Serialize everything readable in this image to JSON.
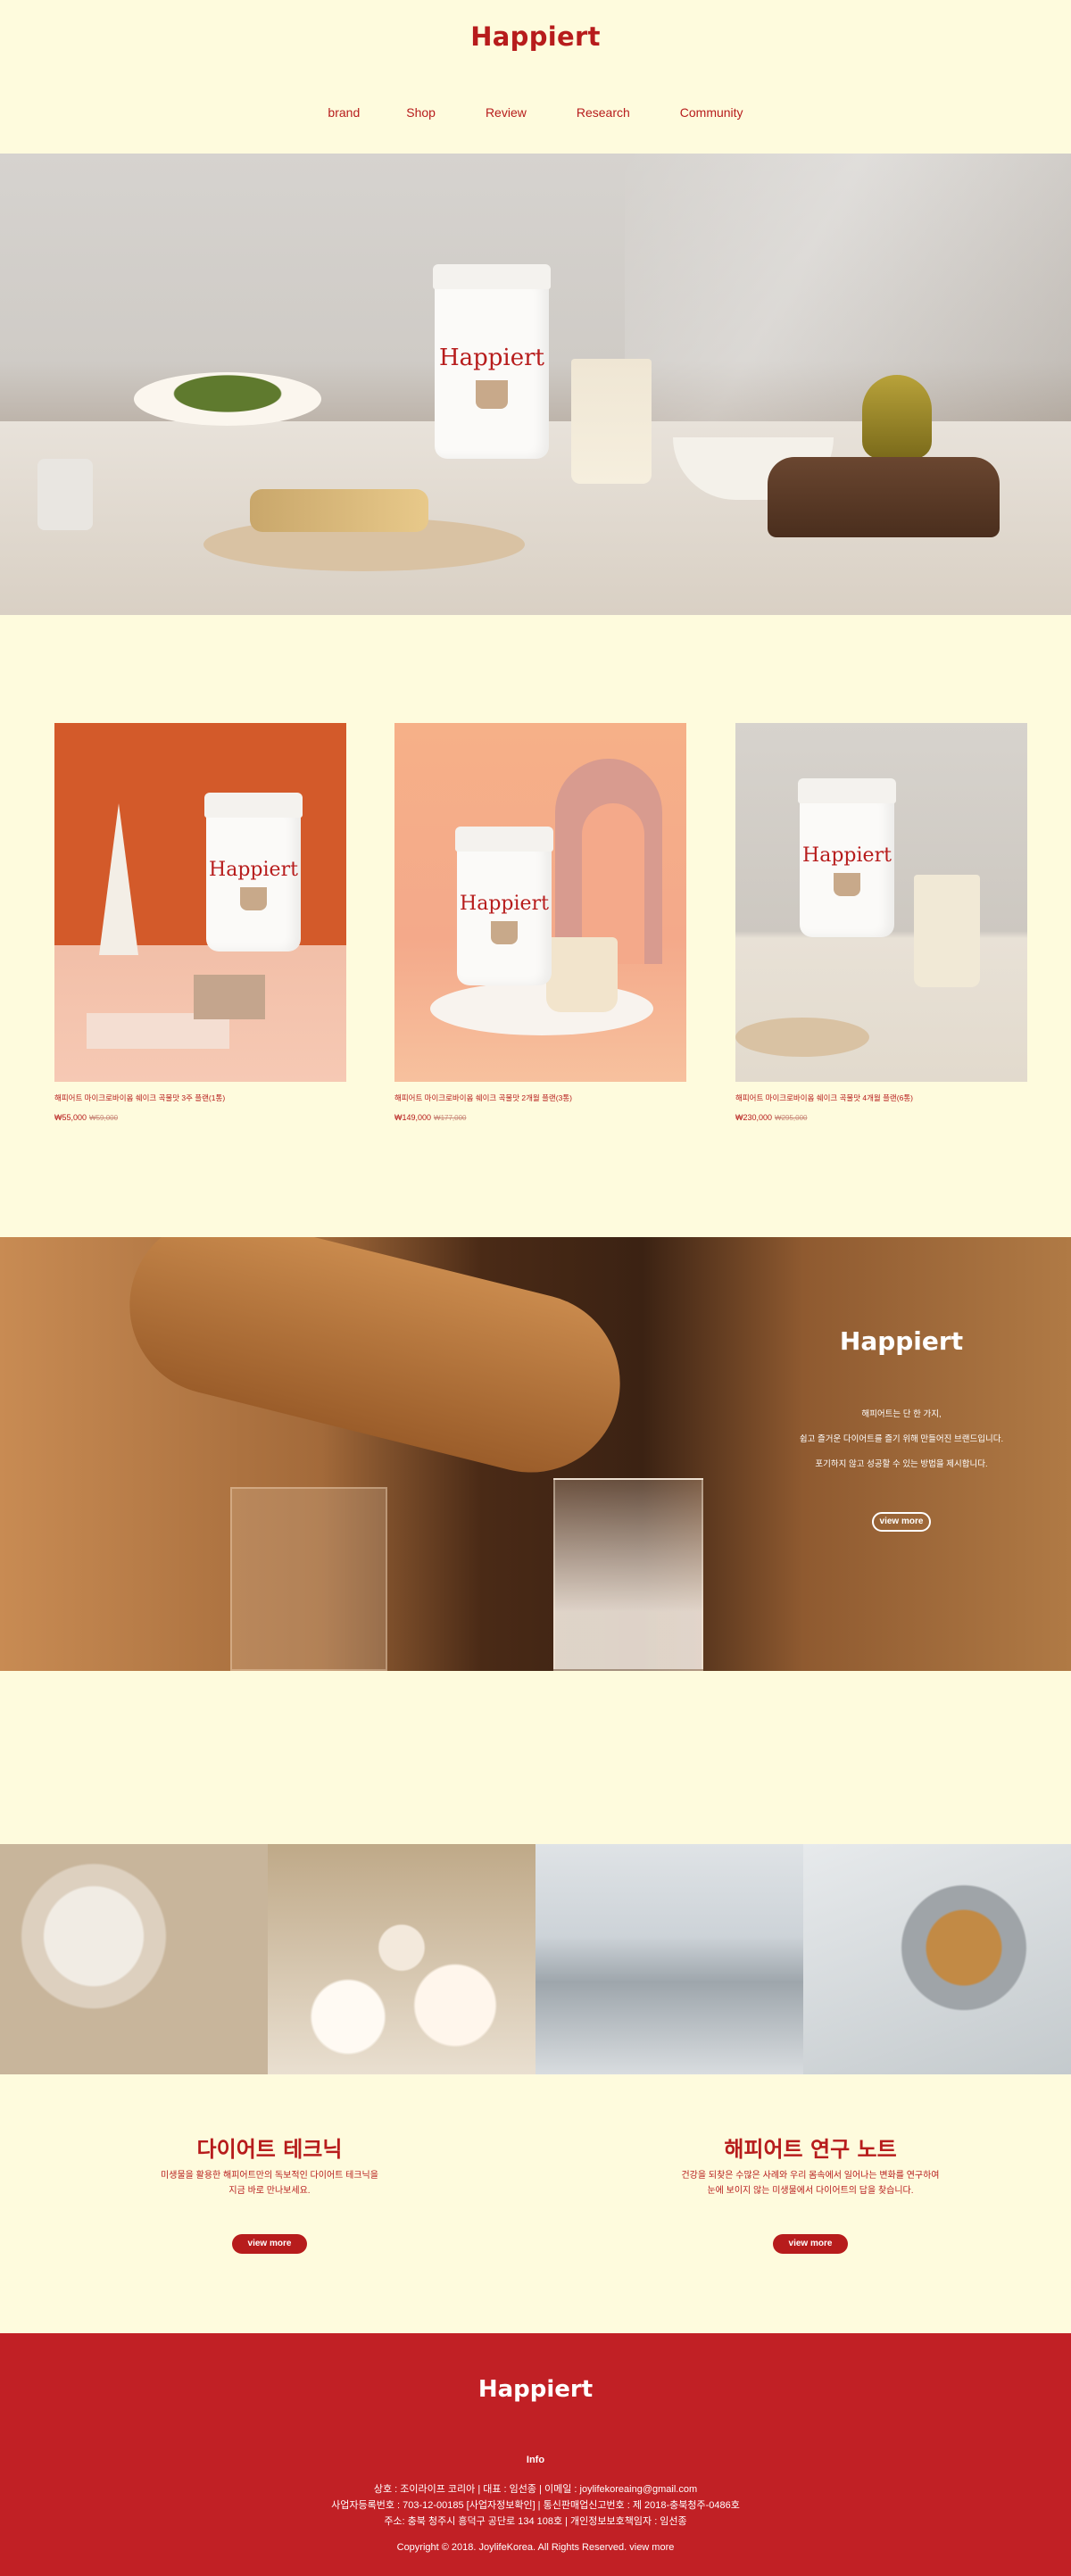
{
  "header": {
    "logo": "Happiert",
    "nav": [
      "brand",
      "Shop",
      "Review",
      "Research",
      "Community"
    ]
  },
  "hero": {
    "jar_label": "Happiert"
  },
  "products": [
    {
      "name": "해피어트 마이크로바이옴 쉐이크 곡물맛 3주 플랜(1통)",
      "price": "₩55,000",
      "old_price": "₩59,000"
    },
    {
      "name": "해피어트 마이크로바이옴 쉐이크 곡물맛 2개월 플랜(3통)",
      "price": "₩149,000",
      "old_price": "₩177,000"
    },
    {
      "name": "해피어트 마이크로바이옴 쉐이크 곡물맛 4개월 플랜(6통)",
      "price": "₩230,000",
      "old_price": "₩295,000"
    }
  ],
  "story": {
    "title": "Happiert",
    "lines": [
      "해피어트는 단 한 가지,",
      "쉽고 즐거운 다이어트를 즐기 위해 만들어진 브랜드입니다.",
      "포기하지 않고 성공할 수 있는 방법을 제시합니다."
    ],
    "button": "view more"
  },
  "columns": [
    {
      "title": "다이어트 테크닉",
      "lines": [
        "미생물을 활용한 해피어트만의 독보적인 다이어트 테크닉을",
        "지금 바로 만나보세요."
      ],
      "button": "view more"
    },
    {
      "title": "해피어트 연구 노트",
      "lines": [
        "건강을 되찾은 수많은 사례와 우리 몸속에서 일어나는 변화를 연구하여",
        "눈에 보이지 않는 미생물에서 다이어트의 답을 찾습니다."
      ],
      "button": "view more"
    }
  ],
  "footer": {
    "logo": "Happiert",
    "info_title": "Info",
    "lines": [
      "상호 : 조이라이프 코리아  |  대표 : 임선종  |  이메일 : joylifekoreaing@gmail.com",
      "사업자등록번호 : 703-12-00185 [사업자정보확인]  |  통신판매업신고번호 : 제 2018-충북청주-0486호",
      "주소: 충북 청주시 흥덕구 공단로 134 108호  |  개인정보보호책임자 : 임선종"
    ],
    "copyright": "Copyright © 2018. JoylifeKorea. All Rights Reserved. view more"
  },
  "colors": {
    "brand_red": "#b71c1c",
    "background": "#fefbdd",
    "footer_red": "#c12025"
  }
}
